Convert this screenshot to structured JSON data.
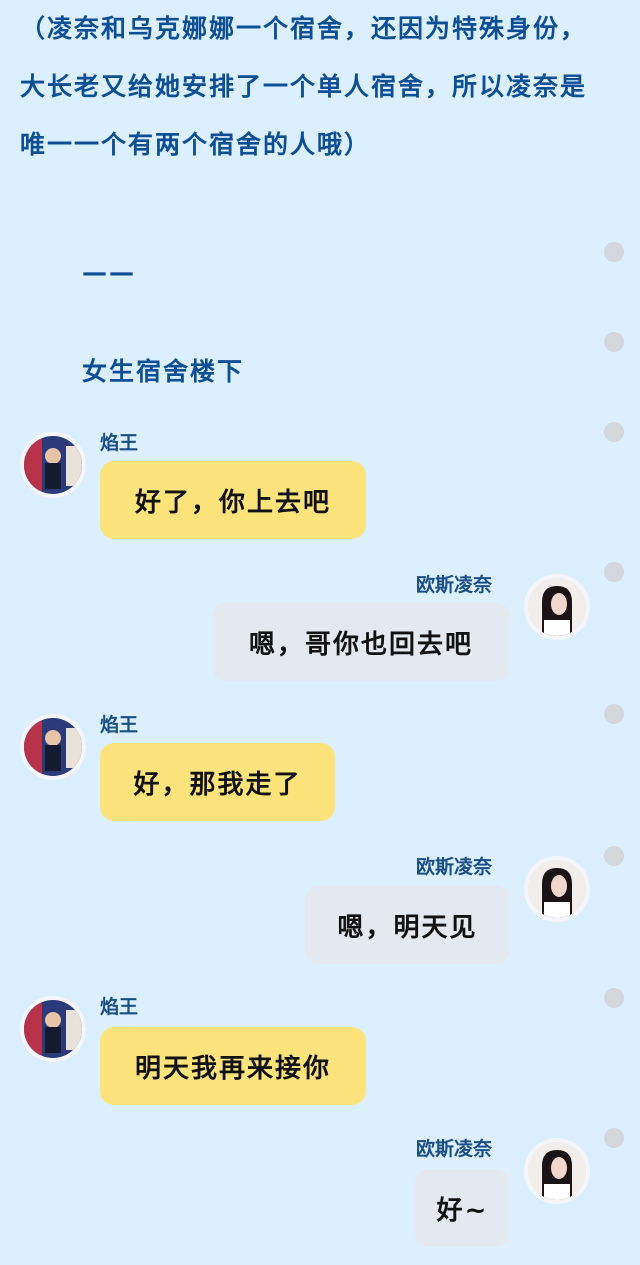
{
  "narration": {
    "paragraph": "（凌奈和乌克娜娜一个宿舍，还因为特殊身份，大长老又给她安排了一个单人宿舍，所以凌奈是唯一一个有两个宿舍的人哦）",
    "divider": "——",
    "scene": "女生宿舍楼下"
  },
  "messages": [
    {
      "sender": "焰王",
      "text": "好了，你上去吧"
    },
    {
      "sender": "欧斯凌奈",
      "text": "嗯，哥你也回去吧"
    },
    {
      "sender": "焰王",
      "text": "好，那我走了"
    },
    {
      "sender": "欧斯凌奈",
      "text": "嗯，明天见"
    },
    {
      "sender": "焰王",
      "text": "明天我再来接你"
    },
    {
      "sender": "欧斯凌奈",
      "text": "好~"
    }
  ],
  "colors": {
    "background": "#dcefff",
    "narration_text": "#0d4f94",
    "sender_name": "#1a4e86",
    "bubble_left": "#fce37b",
    "bubble_right": "#e4e8ef"
  }
}
